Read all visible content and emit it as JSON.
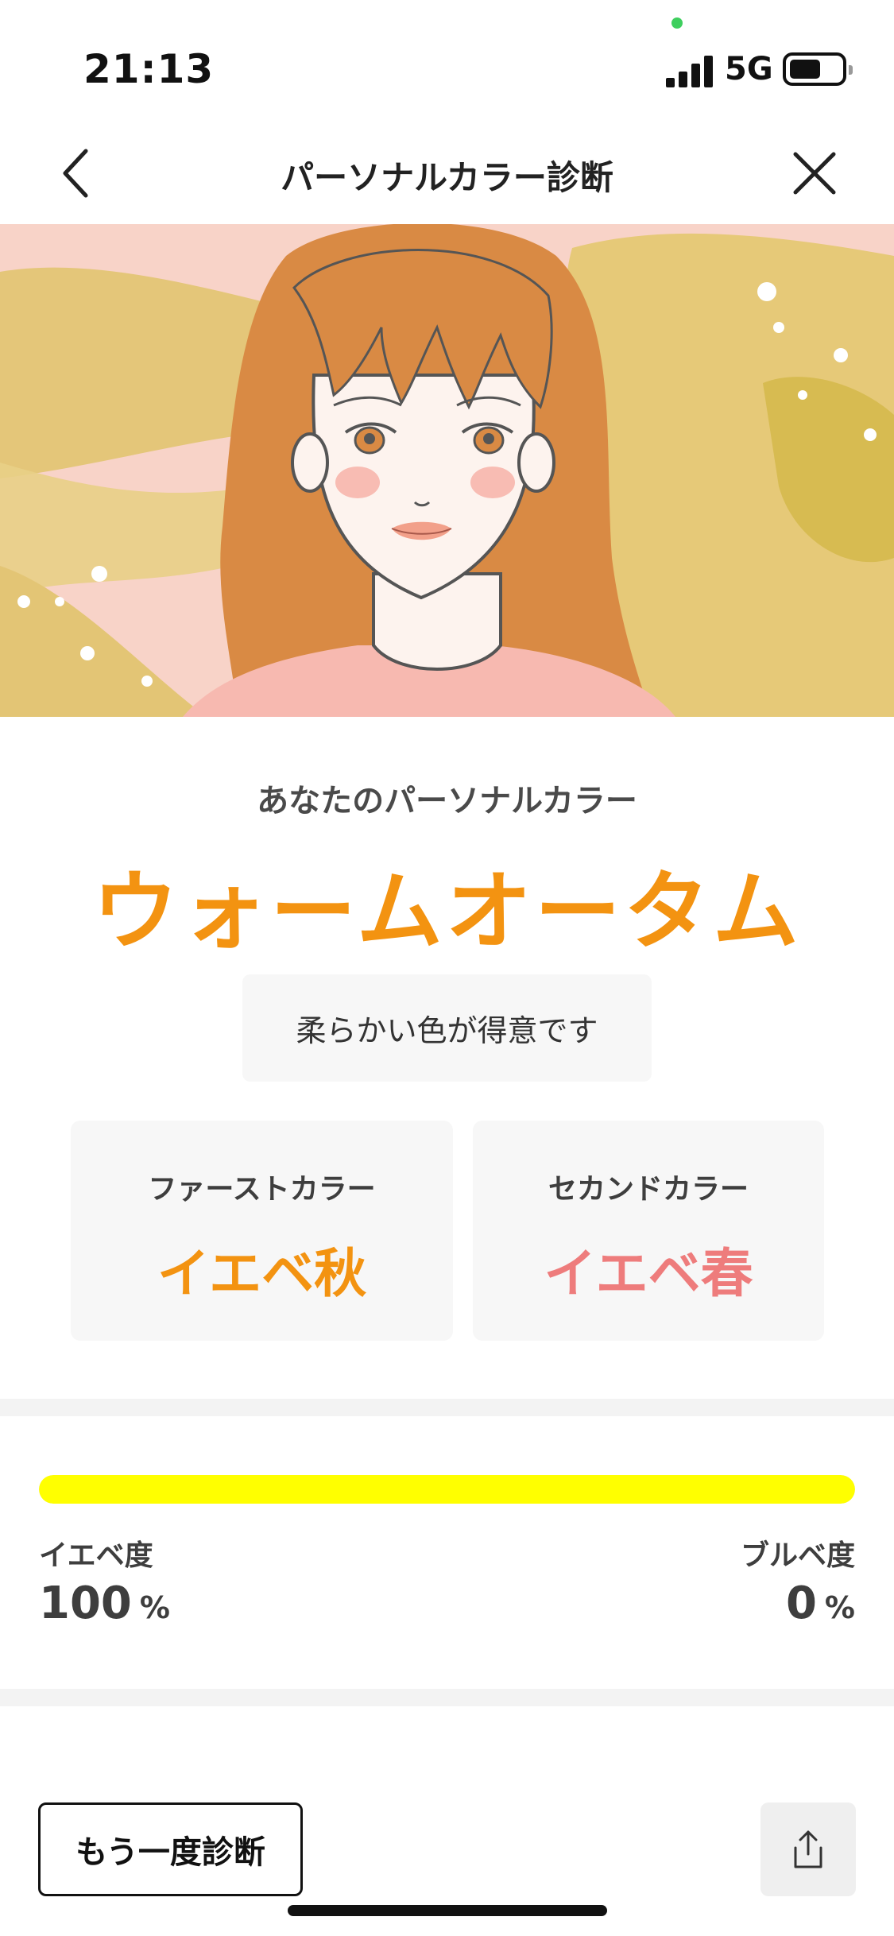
{
  "status_bar": {
    "time": "21:13",
    "network": "5G",
    "signal_bars": 4,
    "battery_level": 0.55,
    "icons": [
      "signal-icon",
      "battery-icon"
    ]
  },
  "nav": {
    "title": "パーソナルカラー診断",
    "back_icon": "chevron-left-icon",
    "close_icon": "close-icon"
  },
  "result": {
    "label": "あなたのパーソナルカラー",
    "type": "ウォームオータム",
    "tagline": "柔らかい色が得意です",
    "first_color": {
      "label": "ファーストカラー",
      "value": "イエベ秋"
    },
    "second_color": {
      "label": "セカンドカラー",
      "value": "イエベ春"
    }
  },
  "score": {
    "yellow_label": "イエベ度",
    "yellow_value": "100",
    "blue_label": "ブルベ度",
    "blue_value": "0",
    "unit": "%",
    "yellow_fraction": 1.0
  },
  "actions": {
    "retry_label": "もう一度診断",
    "share_icon": "share-icon"
  },
  "colors": {
    "accent_orange": "#f39311",
    "accent_pink": "#ee7c7c",
    "progress_yellow": "#ffff00"
  }
}
